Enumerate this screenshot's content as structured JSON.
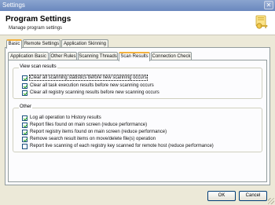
{
  "window": {
    "title": "Settings"
  },
  "header": {
    "title": "Program Settings",
    "subtitle": "Manage program settings",
    "icon": "settings-key-icon"
  },
  "main_tabs": [
    {
      "label": "Basic",
      "active": true
    },
    {
      "label": "Remote Settings",
      "active": false
    },
    {
      "label": "Application Skinning",
      "active": false
    }
  ],
  "sub_tabs": [
    {
      "label": "Application Basic",
      "active": false
    },
    {
      "label": "Other Rules",
      "active": false
    },
    {
      "label": "Scanning Threads",
      "active": false
    },
    {
      "label": "Scan Results",
      "active": true
    },
    {
      "label": "Connection Check",
      "active": false
    }
  ],
  "view_scan_results": {
    "legend": "View scan results",
    "options": [
      {
        "label": "Clear all scanning statistics before new scanning occurs",
        "checked": true
      },
      {
        "label": "Clear all task execution results before new scanning occurs",
        "checked": true
      },
      {
        "label": "Clear all registry scanning results before new scanning occurs",
        "checked": true
      }
    ]
  },
  "other": {
    "legend": "Other",
    "options": [
      {
        "label": "Log all operation to History results",
        "checked": true
      },
      {
        "label": "Report files found on main screen (reduce performance)",
        "checked": true
      },
      {
        "label": "Report registry items found on main screen (reduce performance)",
        "checked": true
      },
      {
        "label": "Remove search result items on move/delete file(s) operation",
        "checked": true
      },
      {
        "label": "Report live scanning of each registry key scanned for remote host (reduce performance)",
        "checked": false
      }
    ]
  },
  "buttons": {
    "ok": "OK",
    "cancel": "Cancel"
  }
}
